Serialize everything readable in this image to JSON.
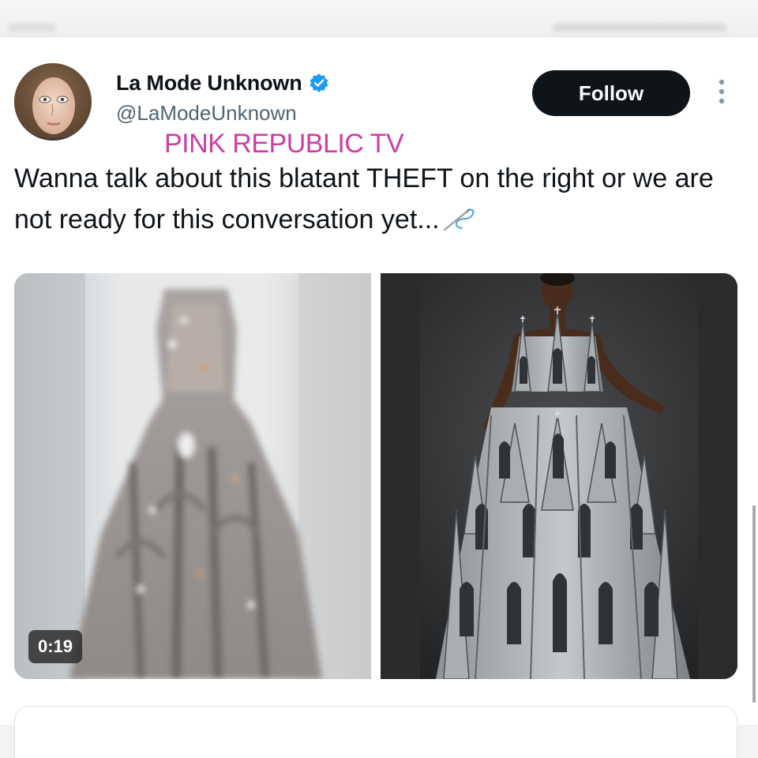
{
  "tweet": {
    "display_name": "La Mode Unknown",
    "handle": "@LaModeUnknown",
    "verified": true,
    "follow_label": "Follow",
    "text": "Wanna talk about this blatant THEFT on the right or we are not ready for this conversation yet...",
    "text_emoji": "sewing-needle-icon"
  },
  "watermark": {
    "text": "PINK REPUBLIC TV",
    "color": "#cc3ea6"
  },
  "media": {
    "video_duration": "0:19"
  },
  "colors": {
    "verified_blue": "#1d9bf0",
    "follow_bg": "#0f1419",
    "handle_gray": "#536471"
  }
}
